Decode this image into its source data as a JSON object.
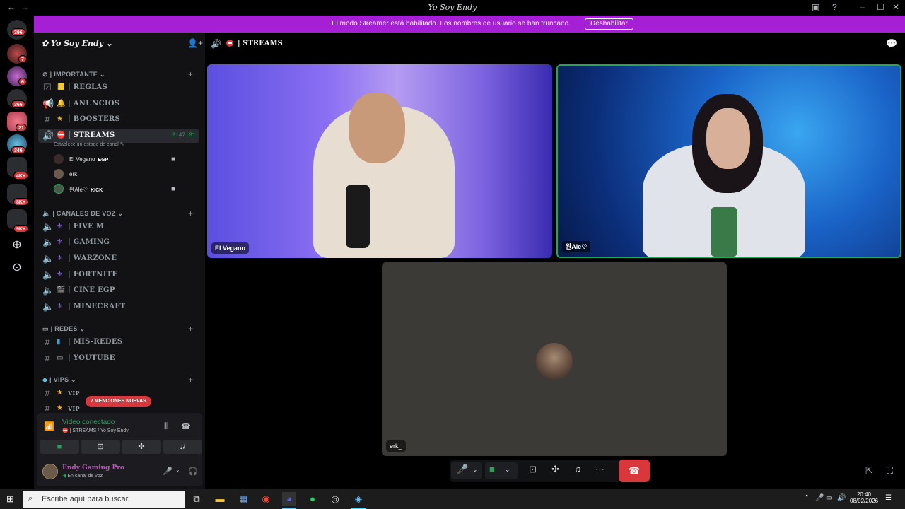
{
  "window": {
    "title": "Yo Soy Endy"
  },
  "banner": {
    "message": "El modo Streamer está habilitado. Los nombres de usuario se han truncado.",
    "button": "Deshabilitar"
  },
  "rail": {
    "badges": [
      "396",
      "7",
      "6",
      "366",
      "21",
      "346",
      "4K+",
      "8K+",
      "9K+"
    ]
  },
  "server": {
    "name": "Yo Soy Endy"
  },
  "categories": [
    {
      "label": "| IMPORTANTE"
    },
    {
      "label": "| CANALES DE VOZ"
    },
    {
      "label": "| REDES"
    },
    {
      "label": "| VIPS"
    }
  ],
  "channels": [
    {
      "label": "| REGLAS",
      "icon": "rules-icon"
    },
    {
      "label": "| ANUNCIOS",
      "icon": "megaphone-icon"
    },
    {
      "label": "| BOOSTERS",
      "icon": "hash-icon"
    },
    {
      "label": "| STREAMS",
      "icon": "speaker-icon",
      "timer": "2:47:01"
    },
    {
      "label": "| FIVE M",
      "icon": "speaker-icon"
    },
    {
      "label": "| GAMING",
      "icon": "speaker-icon"
    },
    {
      "label": "| WARZONE",
      "icon": "speaker-icon"
    },
    {
      "label": "| FORTNITE",
      "icon": "speaker-icon"
    },
    {
      "label": "| CINE EGP",
      "icon": "speaker-icon"
    },
    {
      "label": "| MINECRAFT",
      "icon": "speaker-icon"
    },
    {
      "label": "| MIS-REDES",
      "icon": "hash-icon"
    },
    {
      "label": "| YOUTUBE",
      "icon": "hash-icon"
    },
    {
      "label": "VIP",
      "icon": "hash-icon"
    },
    {
      "label": "VIP",
      "icon": "hash-icon"
    }
  ],
  "channel_status": "Establece un estado de canal",
  "voice_users": [
    {
      "name": "El Vegano",
      "tag": "EGP"
    },
    {
      "name": "erk_",
      "tag": ""
    },
    {
      "name": "완Ale♡",
      "tag": "KICK"
    }
  ],
  "mentions_pill": "7 MENCIONES NUEVAS",
  "voice_panel": {
    "status": "Video conectado",
    "location": "| STREAMS / Yo Soy Endy"
  },
  "user": {
    "name": "Endy Gaming Pro",
    "status": "En canal de voz"
  },
  "main": {
    "channel_title": "| STREAMS"
  },
  "tiles": [
    {
      "label": "El Vegano"
    },
    {
      "label": "완Ale♡"
    },
    {
      "label": "erk_"
    }
  ],
  "taskbar": {
    "search_placeholder": "Escribe aquí para buscar.",
    "time": "20:40",
    "date": "08/02/2026"
  },
  "colors": {
    "banner": "#a51fd5",
    "connected": "#23a55a",
    "hangup": "#da373c",
    "badge": "#da373c",
    "sidebar": "#121214"
  }
}
